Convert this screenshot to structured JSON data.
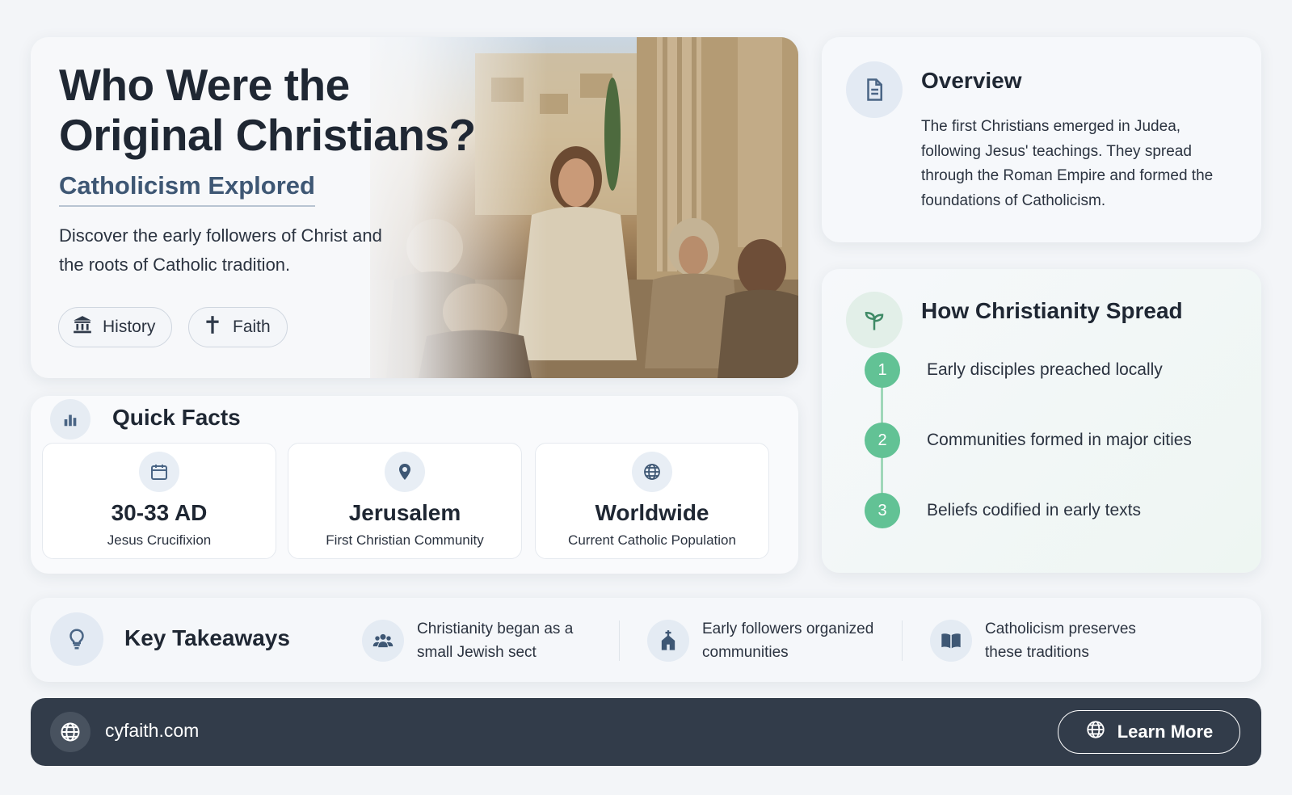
{
  "hero": {
    "title": "Who Were the Original Christians?",
    "subtitle": "Catholicism Explored",
    "description": "Discover the early followers of Christ and the roots of Catholic tradition.",
    "tags": [
      {
        "label": "History",
        "icon": "building-columns-icon"
      },
      {
        "label": "Faith",
        "icon": "cross-icon"
      }
    ]
  },
  "overview": {
    "title": "Overview",
    "icon": "document-icon",
    "text": "The first Christians emerged in Judea, following Jesus' teachings. They spread through the Roman Empire and formed the foundations of Catholicism."
  },
  "spread": {
    "title": "How Christianity Spread",
    "icon": "sprout-icon",
    "steps": [
      {
        "number": "1",
        "text": "Early disciples preached locally"
      },
      {
        "number": "2",
        "text": "Communities formed in major cities"
      },
      {
        "number": "3",
        "text": "Beliefs codified in early texts"
      }
    ]
  },
  "facts": {
    "title": "Quick Facts",
    "icon": "bar-chart-icon",
    "items": [
      {
        "value": "30-33 AD",
        "label": "Jesus Crucifixion",
        "icon": "calendar-icon"
      },
      {
        "value": "Jerusalem",
        "label": "First Christian Community",
        "icon": "map-pin-icon"
      },
      {
        "value": "Worldwide",
        "label": "Current Catholic Population",
        "icon": "globe-icon"
      }
    ]
  },
  "takeaways": {
    "title": "Key Takeaways",
    "icon": "lightbulb-icon",
    "items": [
      {
        "text": "Christianity began as a small Jewish sect",
        "icon": "people-icon"
      },
      {
        "text": "Early followers organized communities",
        "icon": "church-icon"
      },
      {
        "text": "Catholicism preserves these traditions",
        "icon": "book-icon"
      }
    ]
  },
  "footer": {
    "site": "cyfaith.com",
    "button_label": "Learn More"
  },
  "colors": {
    "accent_blue": "#3e5774",
    "accent_green": "#62c295",
    "footer_bg": "#323c4a"
  }
}
